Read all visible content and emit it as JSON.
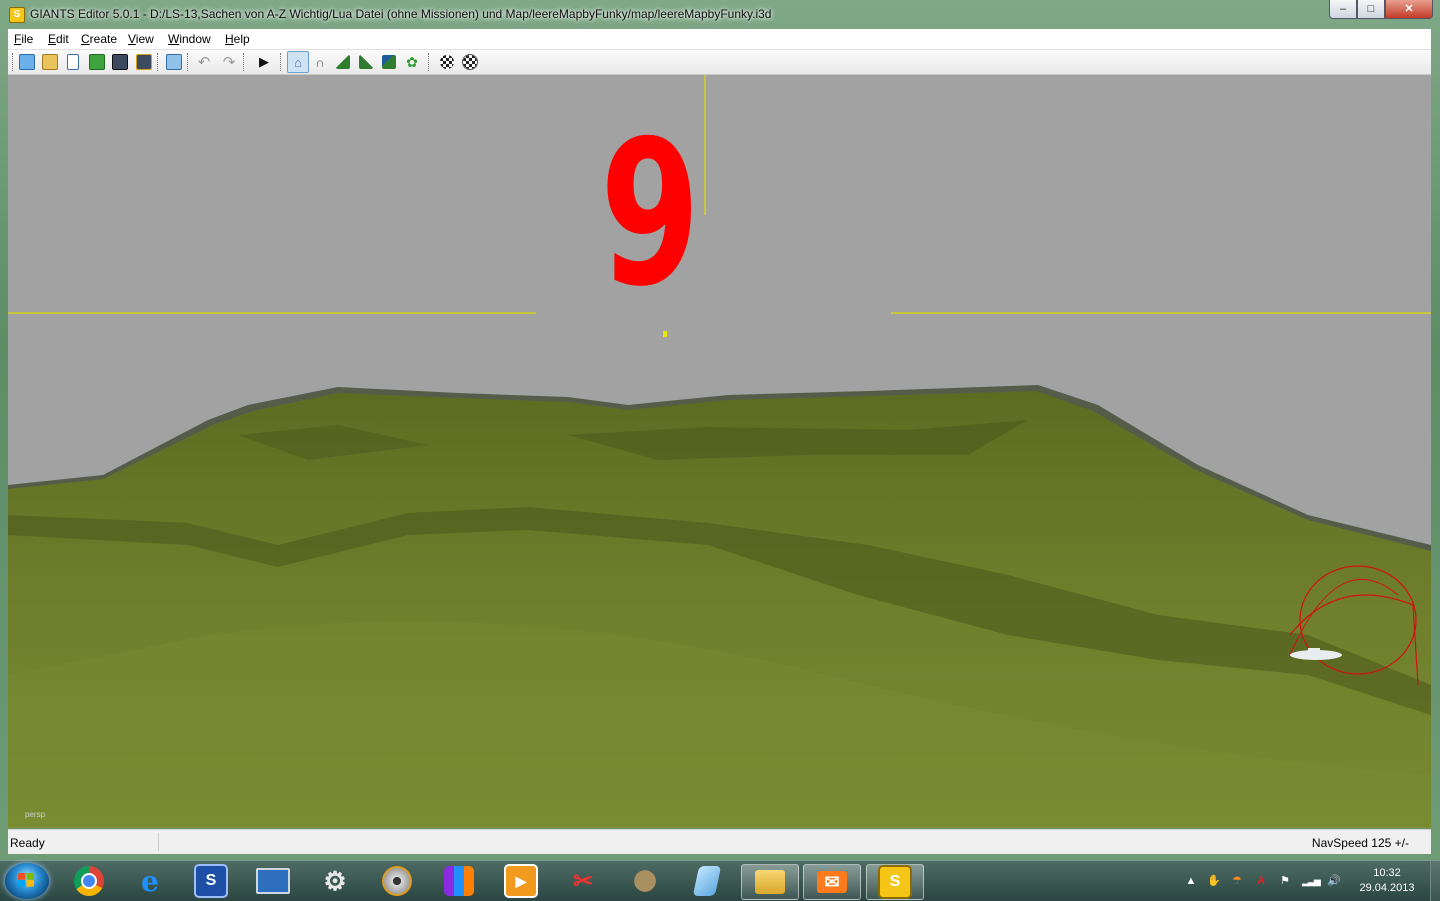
{
  "window": {
    "title": "GIANTS Editor 5.0.1 - D:/LS-13,Sachen von A-Z Wichtig/Lua Datei (ohne Missionen) und Map/leereMapbyFunky/map/leereMapbyFunky.i3d",
    "minimize": "–",
    "maximize": "□",
    "close": "✕"
  },
  "menu": [
    {
      "key": "F",
      "rest": "ile"
    },
    {
      "key": "E",
      "rest": "dit"
    },
    {
      "key": "C",
      "rest": "reate"
    },
    {
      "key": "V",
      "rest": "iew"
    },
    {
      "key": "W",
      "rest": "indow"
    },
    {
      "key": "H",
      "rest": "elp"
    }
  ],
  "toolbar": {
    "icons": [
      "new-file-icon",
      "open-folder-icon",
      "document-icon",
      "refresh-icon",
      "save-icon",
      "save-as-icon",
      "import-icon",
      "undo-icon",
      "redo-icon",
      "play-icon",
      "home-icon",
      "magnet-icon",
      "terrain-icon",
      "terrain-sculpt-icon",
      "terrain-paint-icon",
      "foliage-icon",
      "checker-icon",
      "checker-select-icon"
    ]
  },
  "viewport": {
    "overlay_number": "9",
    "camera_label": "persp",
    "colors": {
      "sky": "#a2a2a2",
      "terrain": "#6b7a2a",
      "guide": "#e0e000",
      "overlay": "#ff0000"
    }
  },
  "status": {
    "left": "Ready",
    "right": "NavSpeed 125 +/-"
  },
  "taskbar": {
    "apps": [
      "chrome-icon",
      "internet-explorer-icon",
      "giants-s-icon",
      "monitor-icon",
      "settings-gear-icon",
      "disc-icon",
      "archive-icon",
      "media-player-icon",
      "scissors-icon",
      "gimp-icon",
      "notepad-icon",
      "file-explorer-icon",
      "mail-icon",
      "giants-editor-icon"
    ],
    "clock_time": "10:32",
    "clock_date": "29.04.2013",
    "tray": [
      "expand-arrow-icon",
      "hand-icon",
      "antivirus-icon",
      "adobe-icon",
      "flag-icon",
      "network-icon",
      "volume-icon"
    ]
  }
}
